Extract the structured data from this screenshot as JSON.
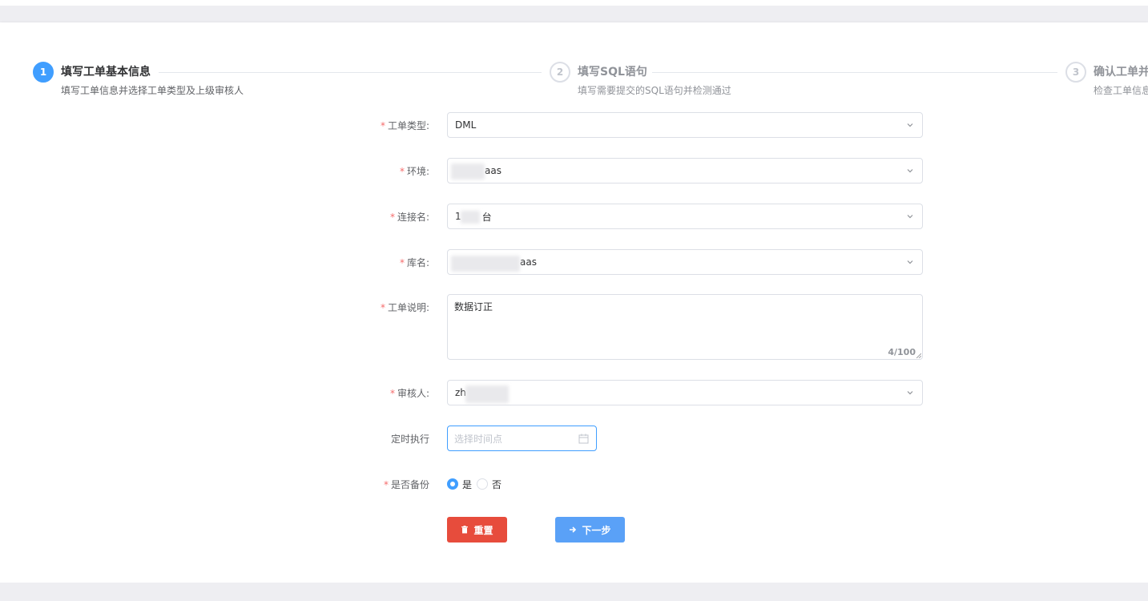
{
  "steps": [
    {
      "number": "1",
      "title": "填写工单基本信息",
      "desc": "填写工单信息并选择工单类型及上级审核人",
      "state": "active"
    },
    {
      "number": "2",
      "title": "填写SQL语句",
      "desc": "填写需要提交的SQL语句并检测通过",
      "state": "idle"
    },
    {
      "number": "3",
      "title": "确认工单并",
      "desc": "检查工单信息",
      "state": "idle"
    }
  ],
  "form": {
    "order_type": {
      "label": "工单类型:",
      "value": "DML"
    },
    "environment": {
      "label": "环境:",
      "value": "aas"
    },
    "connection": {
      "label": "连接名:",
      "value_prefix": "1",
      "value_suffix": "台"
    },
    "database": {
      "label": "库名:",
      "value": "aas"
    },
    "description": {
      "label": "工单说明:",
      "value": "数据订正",
      "counter": "4/100"
    },
    "reviewer": {
      "label": "审核人:",
      "value": "zh"
    },
    "schedule": {
      "label": "定时执行",
      "placeholder": "选择时间点"
    },
    "backup": {
      "label": "是否备份",
      "options": [
        "是",
        "否"
      ],
      "selected": "是"
    }
  },
  "buttons": {
    "reset": "重置",
    "next": "下一步"
  },
  "colors": {
    "primary": "#409eff",
    "danger": "#e74c3c",
    "required": "#f56c6c"
  }
}
